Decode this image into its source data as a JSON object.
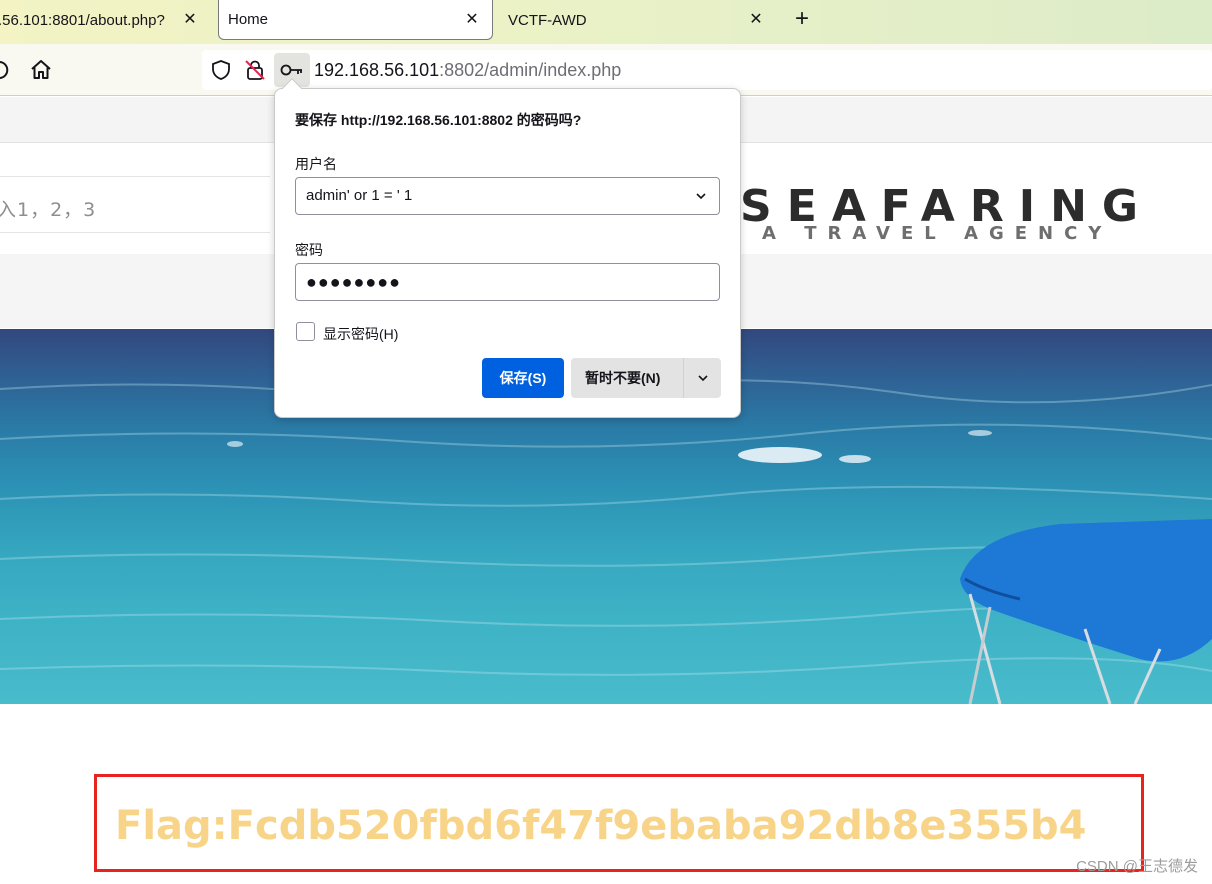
{
  "tabs": [
    {
      "label": ".56.101:8801/about.php?",
      "active": false
    },
    {
      "label": "Home",
      "active": true
    },
    {
      "label": "VCTF-AWD",
      "active": false
    }
  ],
  "toolbar": {
    "url_host": "192.168.56.101",
    "url_rest": ":8802/admin/index.php"
  },
  "page": {
    "side_text": "入1，2，3",
    "logo_title": "SEAFARING",
    "logo_subtitle": "A TRAVEL AGENCY",
    "flag": "Flag:Fcdb520fbd6f47f9ebaba92db8e355b4",
    "watermark": "CSDN @王志德发"
  },
  "password_popup": {
    "title": "要保存 http://192.168.56.101:8802 的密码吗?",
    "username_label": "用户名",
    "username_value": "admin' or 1 = ' 1",
    "password_label": "密码",
    "password_value": "●●●●●●●●",
    "show_password_label": "显示密码(H)",
    "save_label": "保存(S)",
    "not_now_label": "暂时不要(N)"
  },
  "colors": {
    "accent": "#0061e0",
    "flag_text": "#f8d488",
    "flag_border": "#e8231f"
  }
}
